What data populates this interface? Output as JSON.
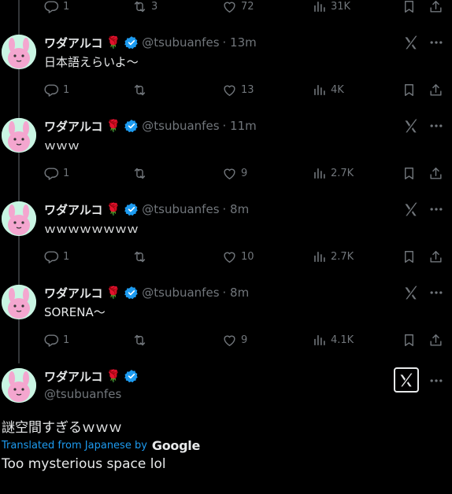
{
  "colors": {
    "background": "#000000",
    "text": "#e7e9ea",
    "muted": "#71767b",
    "accent": "#1d9bf0",
    "rose": "#d3142b"
  },
  "top_partial_actions": {
    "reply_count": "1",
    "retweet_count": "3",
    "like_count": "72",
    "views_count": "31K"
  },
  "tweets": [
    {
      "name": "ワダアルコ",
      "handle": "@tsubuanfes",
      "time": "· 13m",
      "text": "日本語えらいよ〜",
      "reply_count": "1",
      "retweet_count": "",
      "like_count": "13",
      "views_count": "4K"
    },
    {
      "name": "ワダアルコ",
      "handle": "@tsubuanfes",
      "time": "· 11m",
      "text": "ｗｗｗ",
      "reply_count": "1",
      "retweet_count": "",
      "like_count": "9",
      "views_count": "2.7K"
    },
    {
      "name": "ワダアルコ",
      "handle": "@tsubuanfes",
      "time": "· 8m",
      "text": "ｗｗｗｗｗｗｗｗ",
      "reply_count": "1",
      "retweet_count": "",
      "like_count": "10",
      "views_count": "2.7K"
    },
    {
      "name": "ワダアルコ",
      "handle": "@tsubuanfes",
      "time": "· 8m",
      "text": "SORENA〜",
      "reply_count": "1",
      "retweet_count": "",
      "like_count": "9",
      "views_count": "4.1K"
    }
  ],
  "main_tweet": {
    "name": "ワダアルコ",
    "handle": "@tsubuanfes",
    "text": "謎空間すぎるｗｗｗ",
    "translated_label": "Translated from Japanese by",
    "translator_logo": "Google",
    "translation": "Too mysterious space lol"
  },
  "icons": [
    "reply-icon",
    "retweet-icon",
    "like-icon",
    "views-icon",
    "bookmark-icon",
    "share-icon",
    "grok-icon",
    "more-icon",
    "verified-badge-icon",
    "rose-emoji"
  ]
}
